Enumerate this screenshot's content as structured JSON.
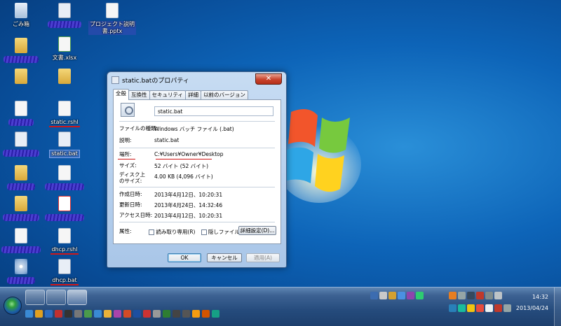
{
  "desktop": {
    "icons": [
      {
        "id": "recycle",
        "label": "ごみ箱",
        "glyph": "bin",
        "style": "plain"
      },
      {
        "id": "hidden1",
        "label": "",
        "glyph": "bat",
        "style": "scribble"
      },
      {
        "id": "project",
        "label": "プロジェクト説明\n書.pptx",
        "glyph": "doc",
        "style": "plain"
      },
      {
        "id": "hidden2",
        "label": "",
        "glyph": "folder",
        "style": "scribble"
      },
      {
        "id": "xls1",
        "label": "文書.xlsx",
        "glyph": "xls",
        "style": "plain"
      },
      {
        "id": "folder1",
        "label": "",
        "glyph": "folder",
        "style": "plain"
      },
      {
        "id": "folder2",
        "label": "",
        "glyph": "folder",
        "style": "plain"
      },
      {
        "id": "hidden3",
        "label": "",
        "glyph": "doc",
        "style": "scribble"
      },
      {
        "id": "static_rshl",
        "label": "static.rshl",
        "glyph": "doc",
        "style": "redul"
      },
      {
        "id": "hidden4",
        "label": "",
        "glyph": "bat",
        "style": "scribble"
      },
      {
        "id": "static_bat",
        "label": "static.bat",
        "glyph": "bat",
        "style": "redul-selected"
      },
      {
        "id": "hidden5",
        "label": "",
        "glyph": "folder",
        "style": "scribble"
      },
      {
        "id": "hidden6",
        "label": "",
        "glyph": "doc",
        "style": "scribble"
      },
      {
        "id": "hidden7",
        "label": "",
        "glyph": "folder",
        "style": "scribble"
      },
      {
        "id": "hidden8",
        "label": "",
        "glyph": "pdf",
        "style": "scribble"
      },
      {
        "id": "hidden9",
        "label": "",
        "glyph": "doc",
        "style": "scribble"
      },
      {
        "id": "dhcp_rshl",
        "label": "dhcp.rshl",
        "glyph": "doc",
        "style": "redul"
      },
      {
        "id": "hidden10",
        "label": "",
        "glyph": "cd",
        "style": "scribble"
      },
      {
        "id": "dhcp_bat",
        "label": "dhcp.bat",
        "glyph": "bat",
        "style": "redul"
      }
    ]
  },
  "dialog": {
    "title": "static.batのプロパティ",
    "close_label": "✕",
    "tabs": [
      "全般",
      "互換性",
      "セキュリティ",
      "詳細",
      "以前のバージョン"
    ],
    "file_name": "static.bat",
    "rows": {
      "type": {
        "k": "ファイルの種類:",
        "v": "Windows バッチ ファイル (.bat)"
      },
      "opens": {
        "k": "説明:",
        "v": "static.bat"
      },
      "location": {
        "k": "場所:",
        "v": "C:¥Users¥Owner¥Desktop"
      },
      "size": {
        "k": "サイズ:",
        "v": "52 バイト (52 バイト)"
      },
      "disk_size": {
        "k": "ディスク上\nのサイズ:",
        "v": "4.00 KB (4,096 バイト)"
      },
      "created": {
        "k": "作成日時:",
        "v": "2013年4月12日、10:20:31"
      },
      "modified": {
        "k": "更新日時:",
        "v": "2013年4月24日、14:32:46"
      },
      "accessed": {
        "k": "アクセス日時:",
        "v": "2013年4月12日、10:20:31"
      },
      "attrs": {
        "k": "属性:"
      }
    },
    "readonly_label": "読み取り専用(R)",
    "hidden_label": "隠しファイル(H)",
    "advanced_label": "詳細設定(D)...",
    "ok_label": "OK",
    "cancel_label": "キャンセル",
    "apply_label": "適用(A)"
  },
  "taskbar": {
    "clock_time": "14:32",
    "clock_date": "2013/04/24"
  }
}
